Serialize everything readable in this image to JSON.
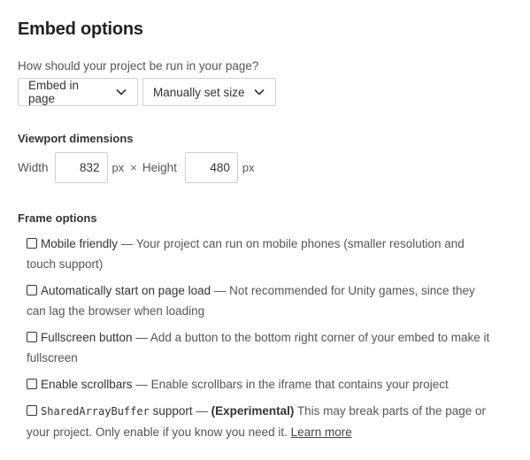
{
  "heading": "Embed options",
  "run_question": "How should your project be run in your page?",
  "embed_select": {
    "value": "Embed in page",
    "icon": "chevron-down-icon"
  },
  "size_select": {
    "value": "Manually set size",
    "icon": "chevron-down-icon"
  },
  "viewport": {
    "label": "Viewport dimensions",
    "width_label": "Width",
    "width_value": "832",
    "width_unit": "px",
    "separator": "×",
    "height_label": "Height",
    "height_value": "480",
    "height_unit": "px"
  },
  "frame": {
    "label": "Frame options",
    "options": [
      {
        "name": "Mobile friendly",
        "description": " — Your project can run on mobile phones (smaller resolution and touch support)",
        "checked": false
      },
      {
        "name": "Automatically start on page load",
        "description": " — Not recommended for Unity games, since they can lag the browser when loading",
        "checked": false
      },
      {
        "name": "Fullscreen button",
        "description": " — Add a button to the bottom right corner of your embed to make it fullscreen",
        "checked": false
      },
      {
        "name": "Enable scrollbars",
        "description": " — Enable scrollbars in the iframe that contains your project",
        "checked": false
      },
      {
        "name_code": "SharedArrayBuffer",
        "name_suffix": " support",
        "separator": " — ",
        "experimental": "(Experimental)",
        "description": " This may break parts of the page or your project. Only enable if you know you need it. ",
        "link": "Learn more",
        "checked": false
      }
    ]
  },
  "colors": {
    "text": "#555555",
    "heading": "#222222",
    "border": "#d0d0d0"
  }
}
